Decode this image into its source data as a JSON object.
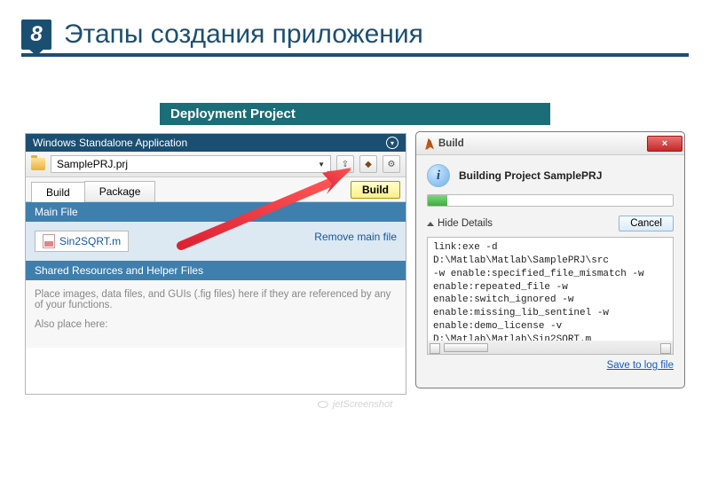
{
  "slide": {
    "number": "8",
    "title": "Этапы создания приложения",
    "banner": "Deployment Project"
  },
  "leftWindow": {
    "title": "Windows Standalone Application",
    "projectFile": "SamplePRJ.prj",
    "tabs": {
      "build": "Build",
      "package": "Package"
    },
    "buildButton": "Build",
    "mainFileHeader": "Main File",
    "mainFile": "Sin2SQRT.m",
    "removeLink": "Remove main file",
    "sharedHeader": "Shared Resources and Helper Files",
    "sharedText": "Place images, data files, and GUIs (.fig files) here if they are referenced by any of your functions.",
    "alsoPlace": "Also place here:"
  },
  "rightDialog": {
    "windowTitle": "Build",
    "close": "×",
    "buildingTitle": "Building Project SamplePRJ",
    "hideDetails": "Hide Details",
    "cancel": "Cancel",
    "log": "link:exe -d D:\\Matlab\\Matlab\\SamplePRJ\\src\n-w enable:specified_file_mismatch -w\nenable:repeated_file -w\nenable:switch_ignored -w\nenable:missing_lib_sentinel -w\nenable:demo_license -v\nD:\\Matlab\\Matlab\\Sin2SQRT.m",
    "saveLink": "Save to log file"
  },
  "watermark": "jetScreenshot"
}
